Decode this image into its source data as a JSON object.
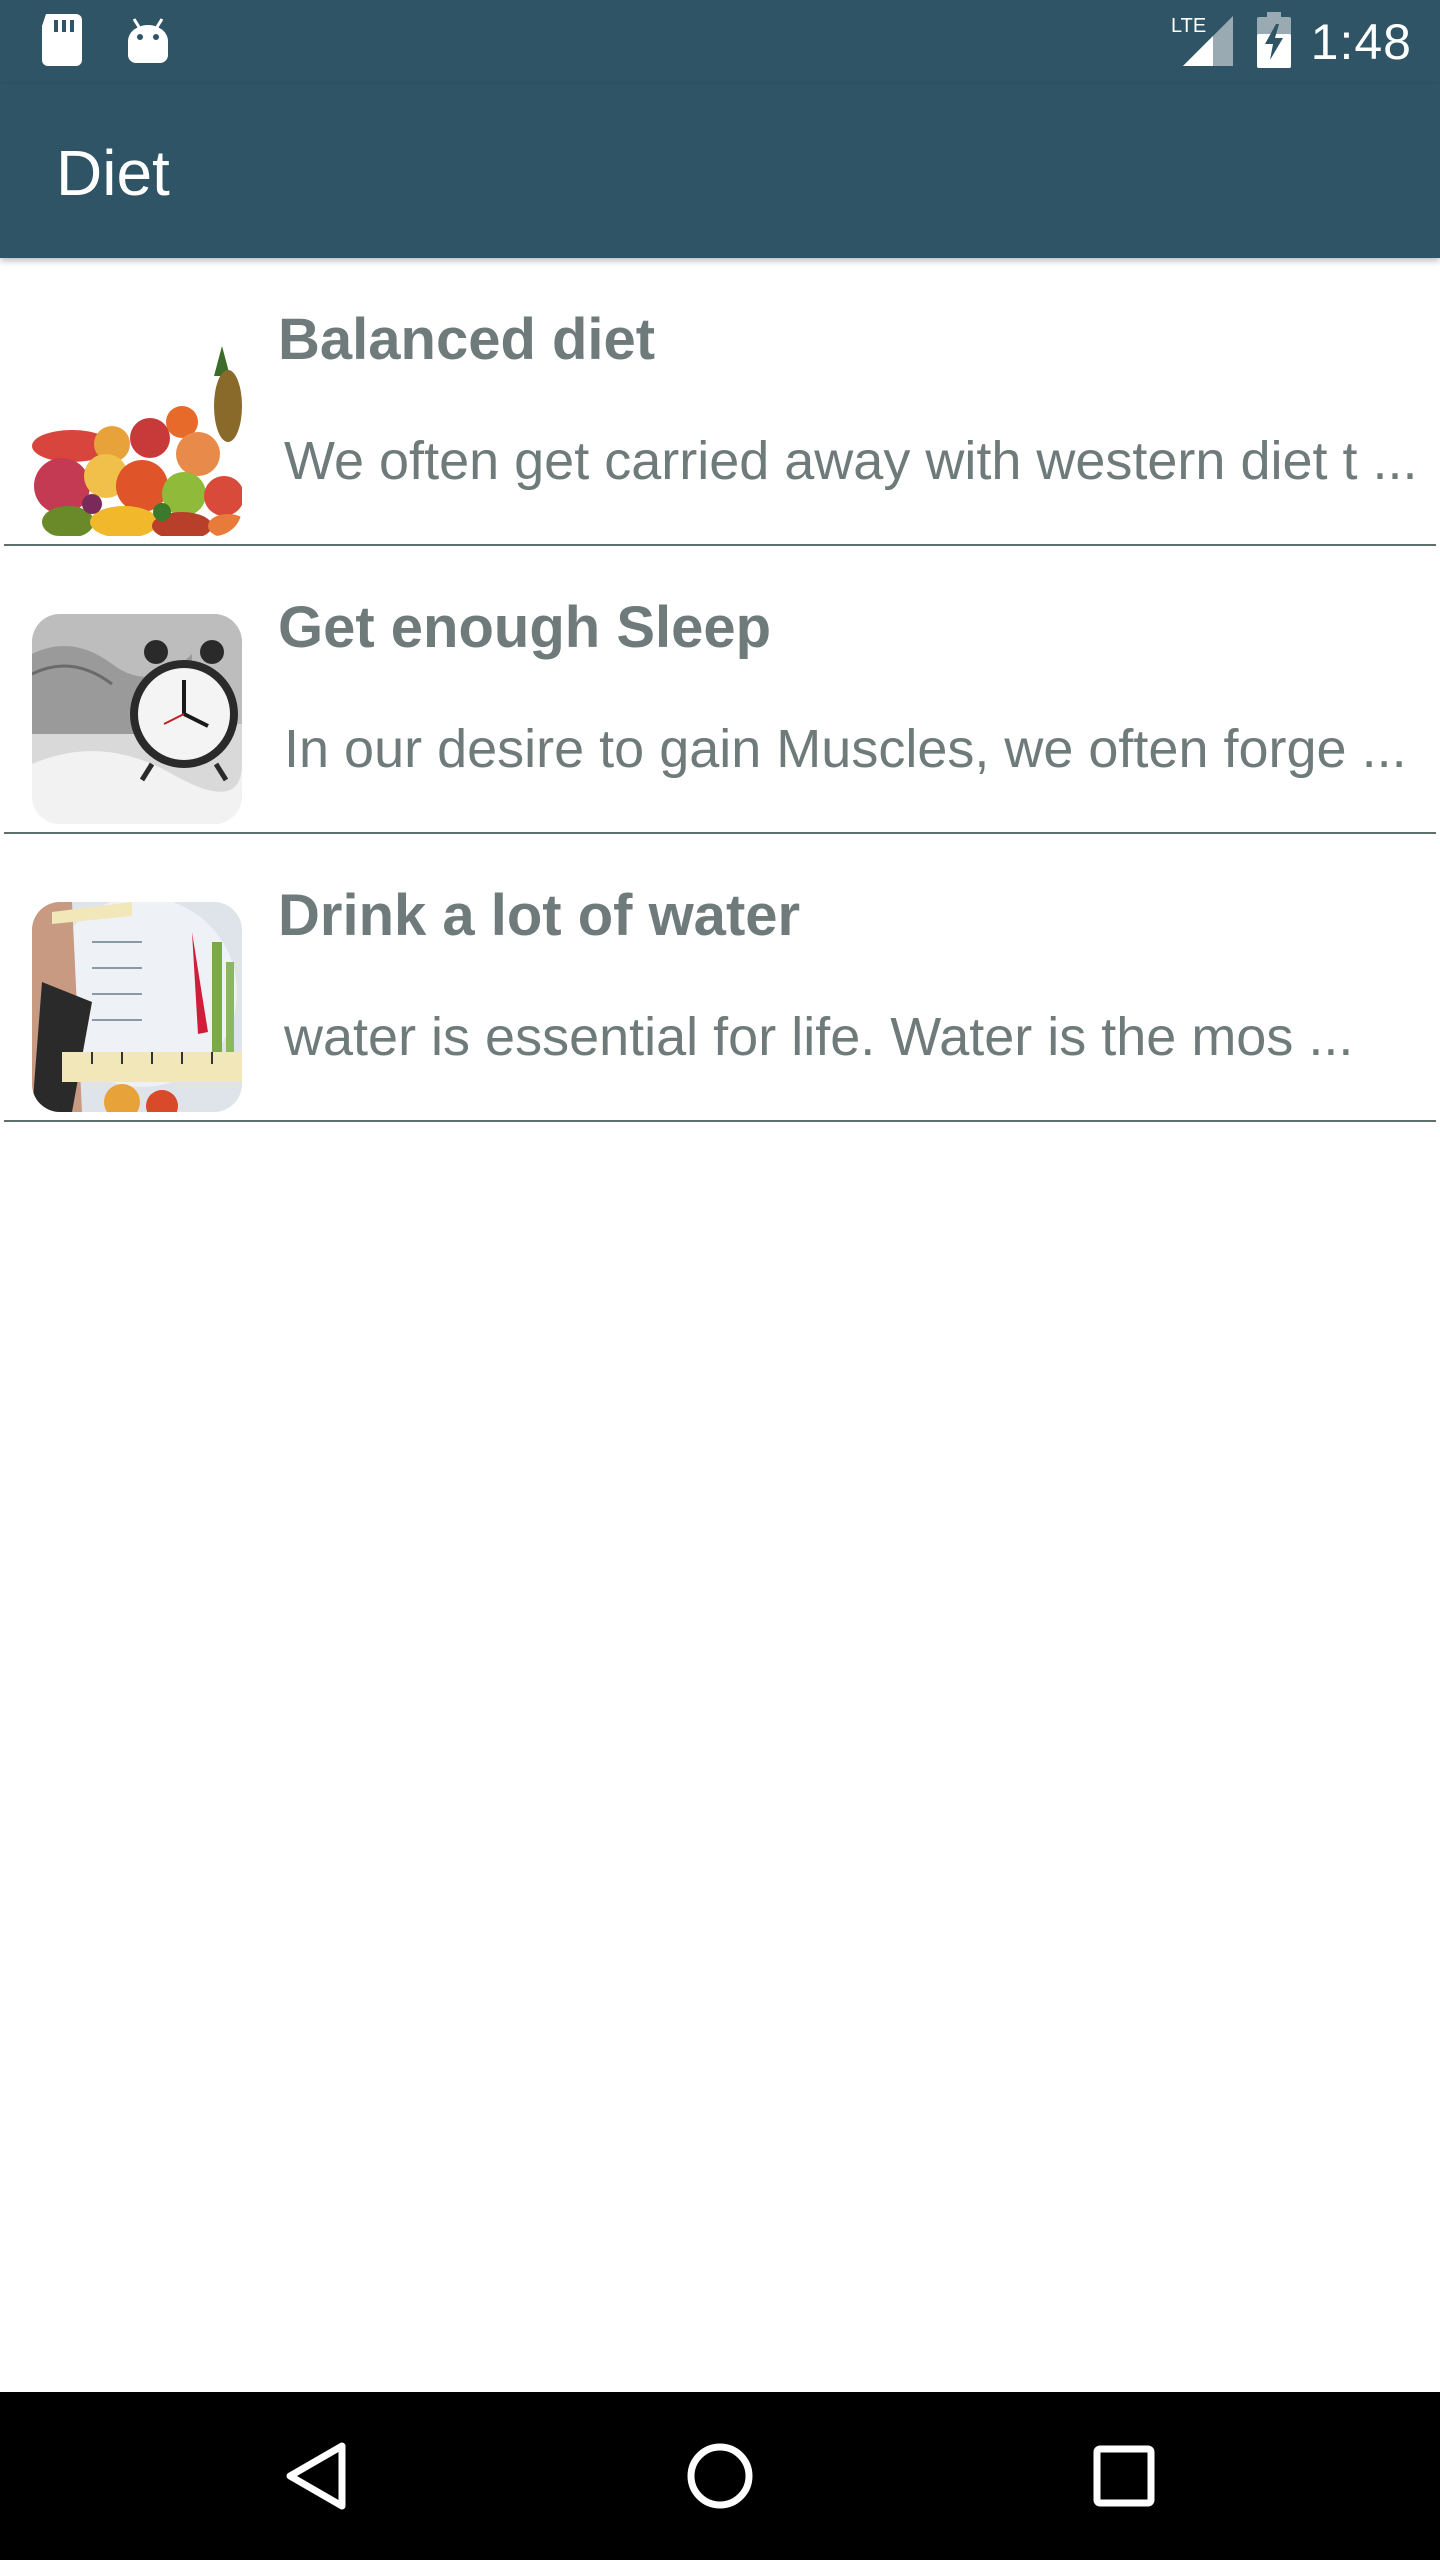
{
  "status_bar": {
    "time": "1:48",
    "network_label": "LTE",
    "icons": [
      "sd-card-icon",
      "android-icon",
      "lte-signal-icon",
      "battery-charging-icon"
    ]
  },
  "app_bar": {
    "title": "Diet"
  },
  "items": [
    {
      "title": "Balanced diet",
      "description": "We often get carried away with western diet t ...",
      "thumbnail": "fruits-image"
    },
    {
      "title": "Get enough Sleep",
      "description": "In our desire to gain Muscles, we often forge ...",
      "thumbnail": "alarm-clock-image"
    },
    {
      "title": "Drink a lot of water",
      "description": "water is essential for life. Water is the mos ...",
      "thumbnail": "scale-measuring-tape-image"
    }
  ],
  "nav_bar": {
    "buttons": [
      "back-icon",
      "home-icon",
      "recents-icon"
    ]
  },
  "colors": {
    "primary": "#2e5466",
    "text": "#6e7b7a",
    "divider": "#5f6f6e"
  }
}
